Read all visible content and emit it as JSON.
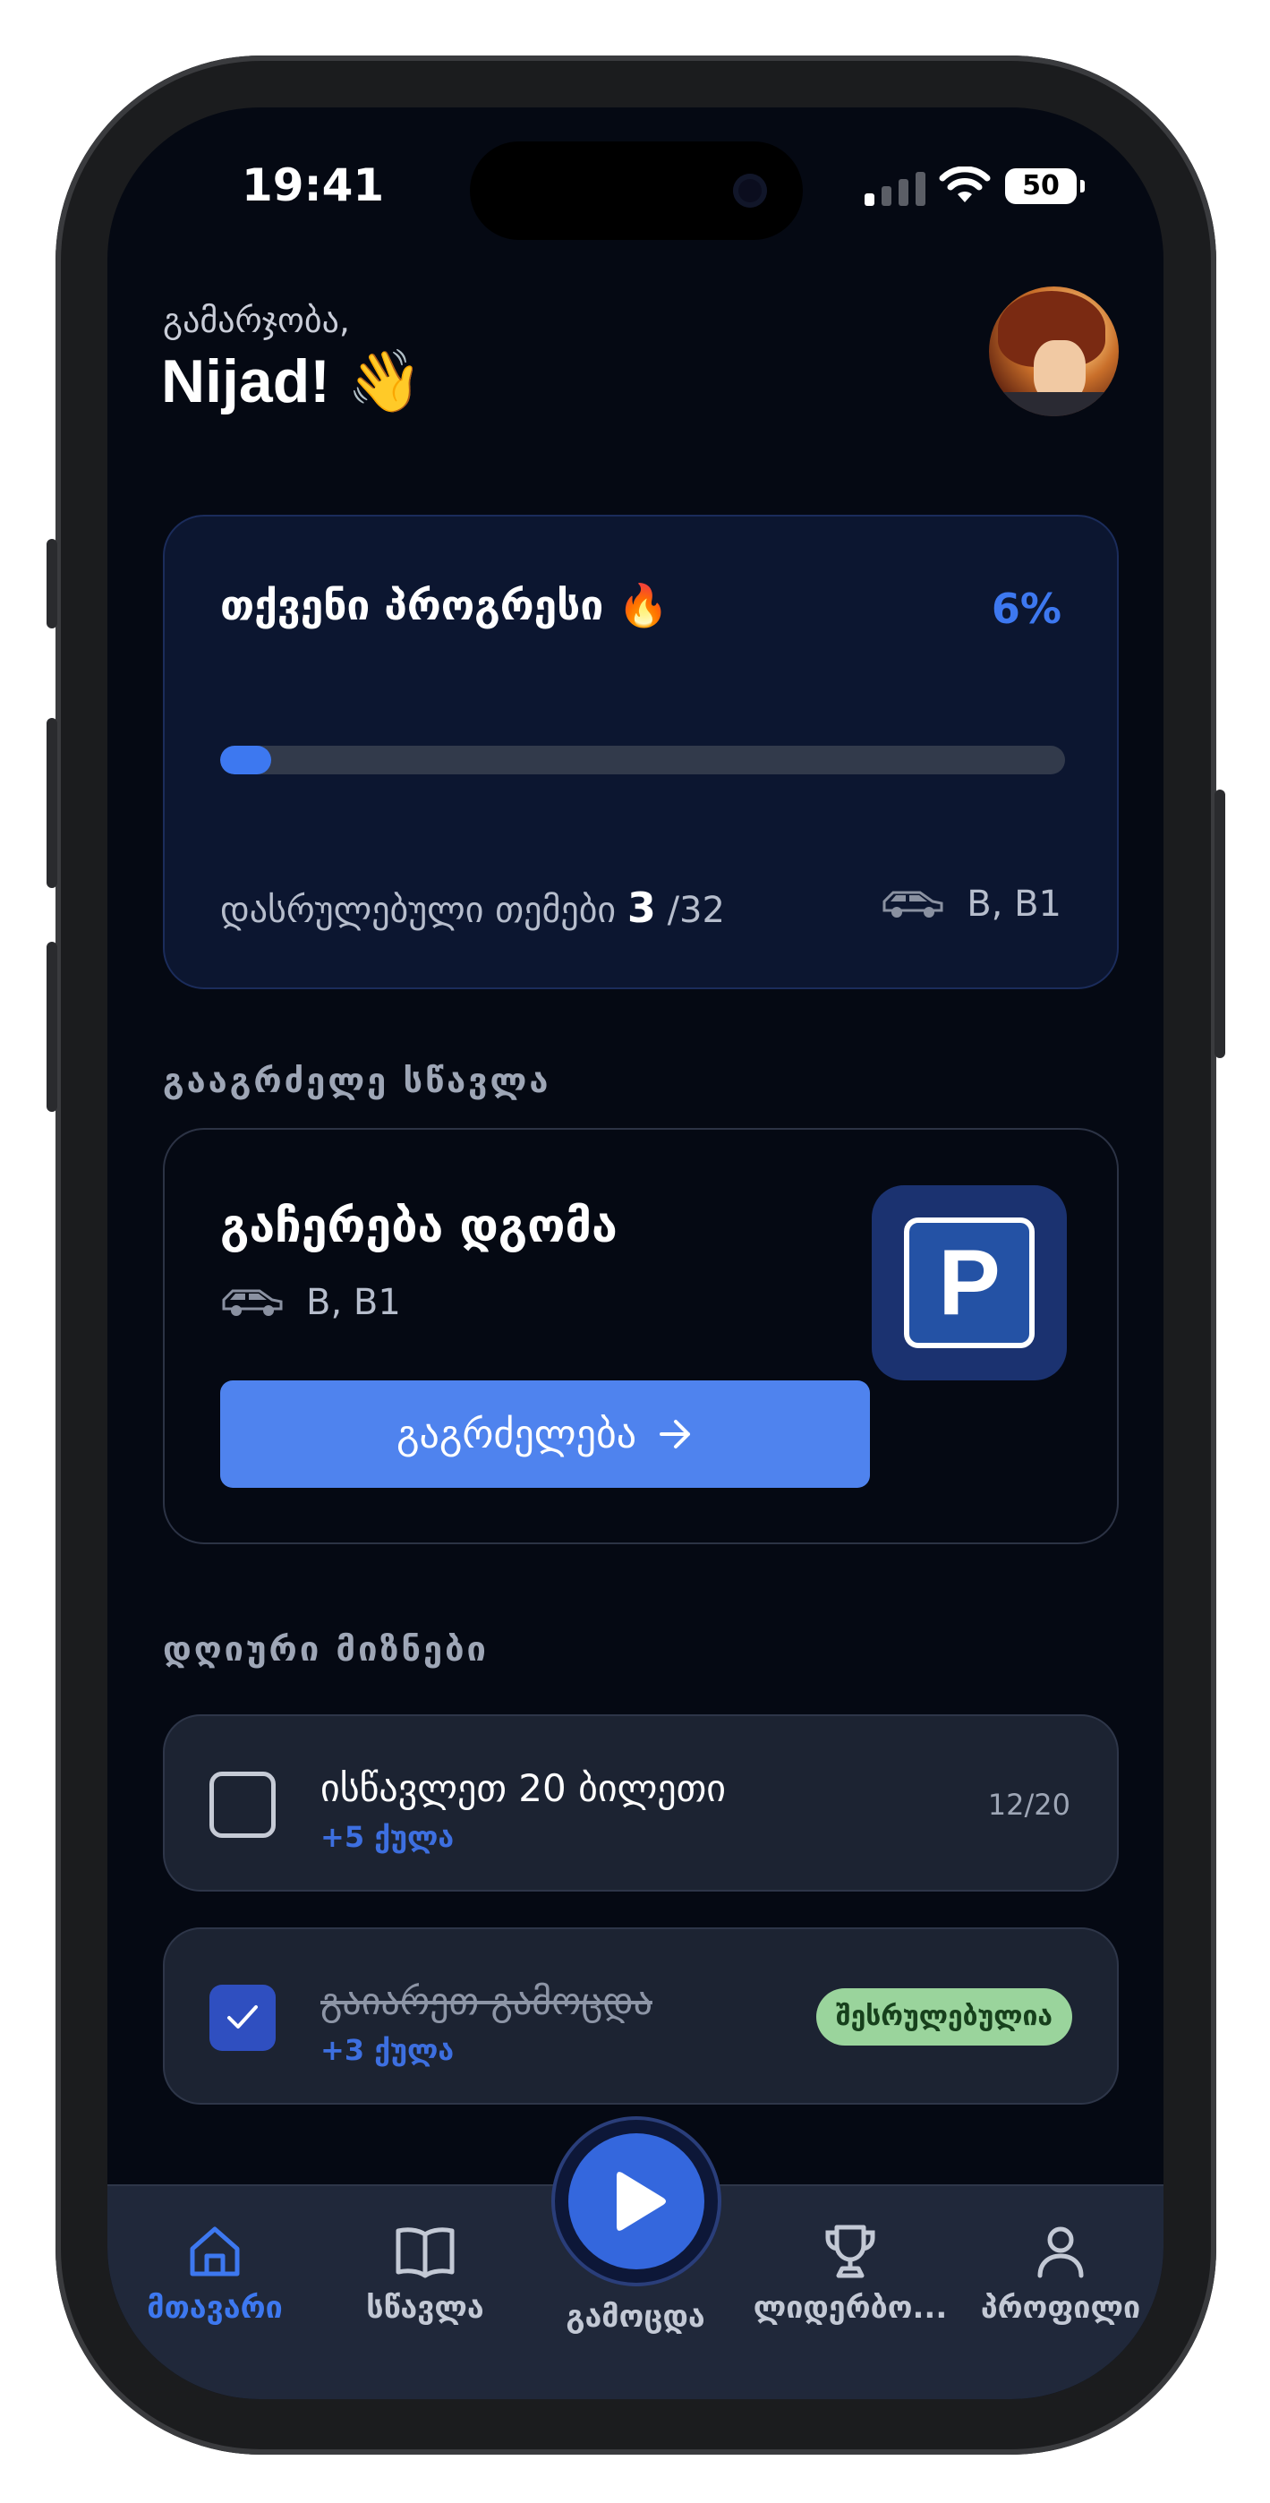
{
  "status_bar": {
    "time": "19:41",
    "battery": "50"
  },
  "header": {
    "greeting": "გამარჯობა,",
    "name": "Nijad! 👋"
  },
  "progress": {
    "title": "თქვენი პროგრესი 🔥",
    "percent_label": "6%",
    "percent_value": 6,
    "topics_label": "დასრულებული თემები",
    "topics_done": "3",
    "topics_total": "/32",
    "category": "B, B1"
  },
  "continue_section": {
    "label": "გააგრძელე სწავლა",
    "title": "გაჩერება დგომა",
    "category": "B, B1",
    "sign": "P",
    "button": "გაგრძელება"
  },
  "daily_goals": {
    "label": "დღიური მიზნები",
    "goals": [
      {
        "name": "ისწავლეთ 20 ბილეთი",
        "points": "+5 ქულა",
        "progress": "12/20",
        "done": false
      },
      {
        "name": "გაიარეთ გამოცდა",
        "points": "+3 ქულა",
        "badge": "შესრულებულია",
        "done": true
      }
    ]
  },
  "tabbar": {
    "tabs": [
      {
        "label": "მთავარი",
        "icon": "home-icon",
        "active": true
      },
      {
        "label": "სწავლა",
        "icon": "book-icon"
      },
      {
        "label": "გამოცდა",
        "icon": "play-icon"
      },
      {
        "label": "ლიდერბო...",
        "icon": "trophy-icon"
      },
      {
        "label": "პროფილი",
        "icon": "user-icon"
      }
    ]
  },
  "colors": {
    "accent": "#3d78f0",
    "background": "#050913",
    "card": "#1c2332",
    "success": "#9ad49c"
  }
}
